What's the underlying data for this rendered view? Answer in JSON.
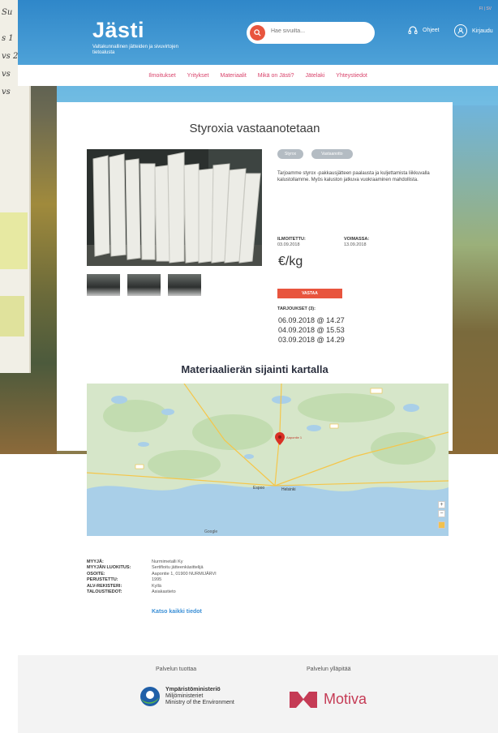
{
  "header": {
    "logo": "Jästi",
    "tagline": "Valtakunnallinen jätteiden ja sivuvirtojen tietoalusta",
    "search_placeholder": "Hae sivuilta...",
    "help_label": "Ohjeet",
    "login_label": "Kirjaudu",
    "lang": "FI | SV"
  },
  "nav": [
    "Ilmoitukset",
    "Yritykset",
    "Materiaalit",
    "Mikä on Jästi?",
    "Jätelaki",
    "Yhteystiedot"
  ],
  "listing": {
    "title": "Styroxia vastaanotetaan",
    "tags": [
      "Styrox",
      "Vastaanotto"
    ],
    "description": "Tarjoamme styrox -pakkausjätteen paalausta ja kuljettamista liikkuvalla kalustollamme. Myös kaluston jatkuva vuokraaminen mahdollista.",
    "announced_label": "ILMOITETTU:",
    "announced_value": "03.09.2018",
    "valid_label": "VOIMASSA:",
    "valid_value": "13.09.2018",
    "price": "€/kg",
    "reply_button": "VASTAA",
    "offers_label": "TARJOUKSET (3):",
    "offers": [
      "06.09.2018 @ 14.27",
      "04.09.2018 @ 15.53",
      "03.09.2018 @ 14.29"
    ]
  },
  "map": {
    "title": "Materiaalierän sijainti kartalla",
    "marker_label": "Aapontie 1",
    "city_label": "Helsinki",
    "city2_label": "Espoo",
    "google_label": "Google",
    "zoom_in": "+",
    "zoom_out": "−"
  },
  "seller": {
    "rows": [
      {
        "key": "MYYJÄ:",
        "value": "Nurmimetalli Ky"
      },
      {
        "key": "MYYJÄN LUOKITUS:",
        "value": "Sertifioitu jätteenkäsittelijä"
      },
      {
        "key": "OSOITE:",
        "value": "Aapontie 1, 01900 NURMIJÄRVI"
      },
      {
        "key": "PERUSTETTU:",
        "value": "1995"
      },
      {
        "key": "ALV-REKISTERI:",
        "value": "Kyllä"
      },
      {
        "key": "TALOUSTIEDOT:",
        "value": "Asiakastieto"
      }
    ],
    "link": "Katso kaikki tiedot"
  },
  "footer": {
    "produced_label": "Palvelun tuottaa",
    "maintained_label": "Palvelun ylläpitää",
    "ministry_name_fi": "Ympäristöministeriö",
    "ministry_name_sv": "Miljöministeriet",
    "ministry_name_en": "Ministry of the Environment",
    "motiva": "Motiva"
  },
  "colors": {
    "accent": "#e8553e",
    "nav": "#d9436b",
    "header": "#2f87c9",
    "link": "#3a8fd6",
    "motiva": "#c53b55"
  }
}
